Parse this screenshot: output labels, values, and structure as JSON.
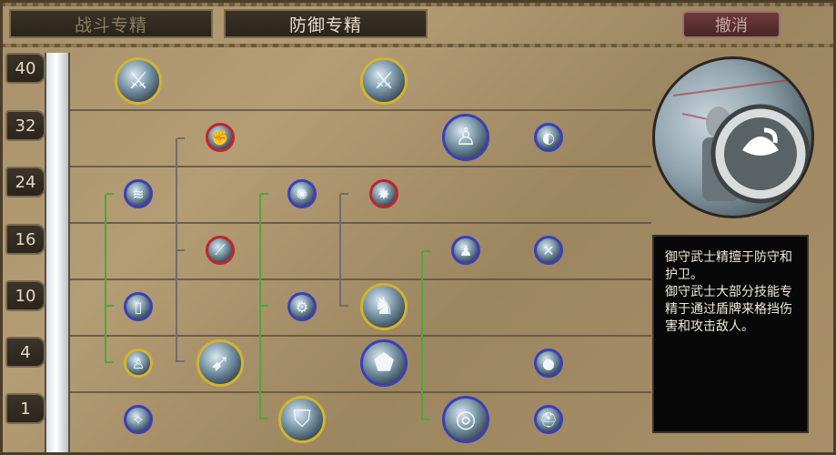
{
  "tabs": [
    {
      "label": "战斗专精",
      "active": false
    },
    {
      "label": "防御专精",
      "active": true
    }
  ],
  "cancel_label": "撤消",
  "tiers": [
    "40",
    "32",
    "24",
    "16",
    "10",
    "4",
    "1"
  ],
  "description": {
    "line1": "御守武士精擅于防守和护卫。",
    "line2": "御守武士大部分技能专精于通过盾牌来格挡伤害和攻击敌人。"
  },
  "colors": {
    "gold": "#d3b42c",
    "blue": "#3b3fb8",
    "red": "#c2242a",
    "prereq_green": "#4ea83a",
    "prereq_grey": "#6e6e6e"
  },
  "skills": [
    {
      "tier": "40",
      "icon": "claw-slash-icon",
      "ring": "gold",
      "size": "large"
    },
    {
      "tier": "40",
      "icon": "sword-strike-icon",
      "ring": "gold",
      "size": "large"
    },
    {
      "tier": "32",
      "icon": "fist-blow-icon",
      "ring": "red",
      "size": "small"
    },
    {
      "tier": "32",
      "icon": "warrior-pose-icon",
      "ring": "blue",
      "size": "large"
    },
    {
      "tier": "32",
      "icon": "slash-arc-icon",
      "ring": "blue",
      "size": "small"
    },
    {
      "tier": "24",
      "icon": "wind-slash-icon",
      "ring": "blue",
      "size": "small"
    },
    {
      "tier": "24",
      "icon": "spin-attack-icon",
      "ring": "blue",
      "size": "small"
    },
    {
      "tier": "24",
      "icon": "strike-burst-icon",
      "ring": "red",
      "size": "small"
    },
    {
      "tier": "16",
      "icon": "blade-cut-icon",
      "ring": "red",
      "size": "small"
    },
    {
      "tier": "16",
      "icon": "warrior-stance-icon",
      "ring": "blue",
      "size": "small"
    },
    {
      "tier": "16",
      "icon": "weapon-cross-icon",
      "ring": "blue",
      "size": "small"
    },
    {
      "tier": "10",
      "icon": "scroll-icon",
      "ring": "blue",
      "size": "small"
    },
    {
      "tier": "10",
      "icon": "gear-shield-icon",
      "ring": "blue",
      "size": "small"
    },
    {
      "tier": "10",
      "icon": "armored-knight-icon",
      "ring": "gold",
      "size": "large"
    },
    {
      "tier": "4",
      "icon": "figure-icon",
      "ring": "gold",
      "size": "small"
    },
    {
      "tier": "4",
      "icon": "leap-attack-icon",
      "ring": "gold",
      "size": "large"
    },
    {
      "tier": "4",
      "icon": "shield-icon",
      "ring": "blue",
      "size": "large"
    },
    {
      "tier": "4",
      "icon": "orb-icon",
      "ring": "blue",
      "size": "small"
    },
    {
      "tier": "1",
      "icon": "energy-icon",
      "ring": "blue",
      "size": "small"
    },
    {
      "tier": "1",
      "icon": "shield-block-icon",
      "ring": "gold",
      "size": "large"
    },
    {
      "tier": "1",
      "icon": "round-shield-icon",
      "ring": "blue",
      "size": "large"
    },
    {
      "tier": "1",
      "icon": "helmet-icon",
      "ring": "blue",
      "size": "small"
    }
  ]
}
